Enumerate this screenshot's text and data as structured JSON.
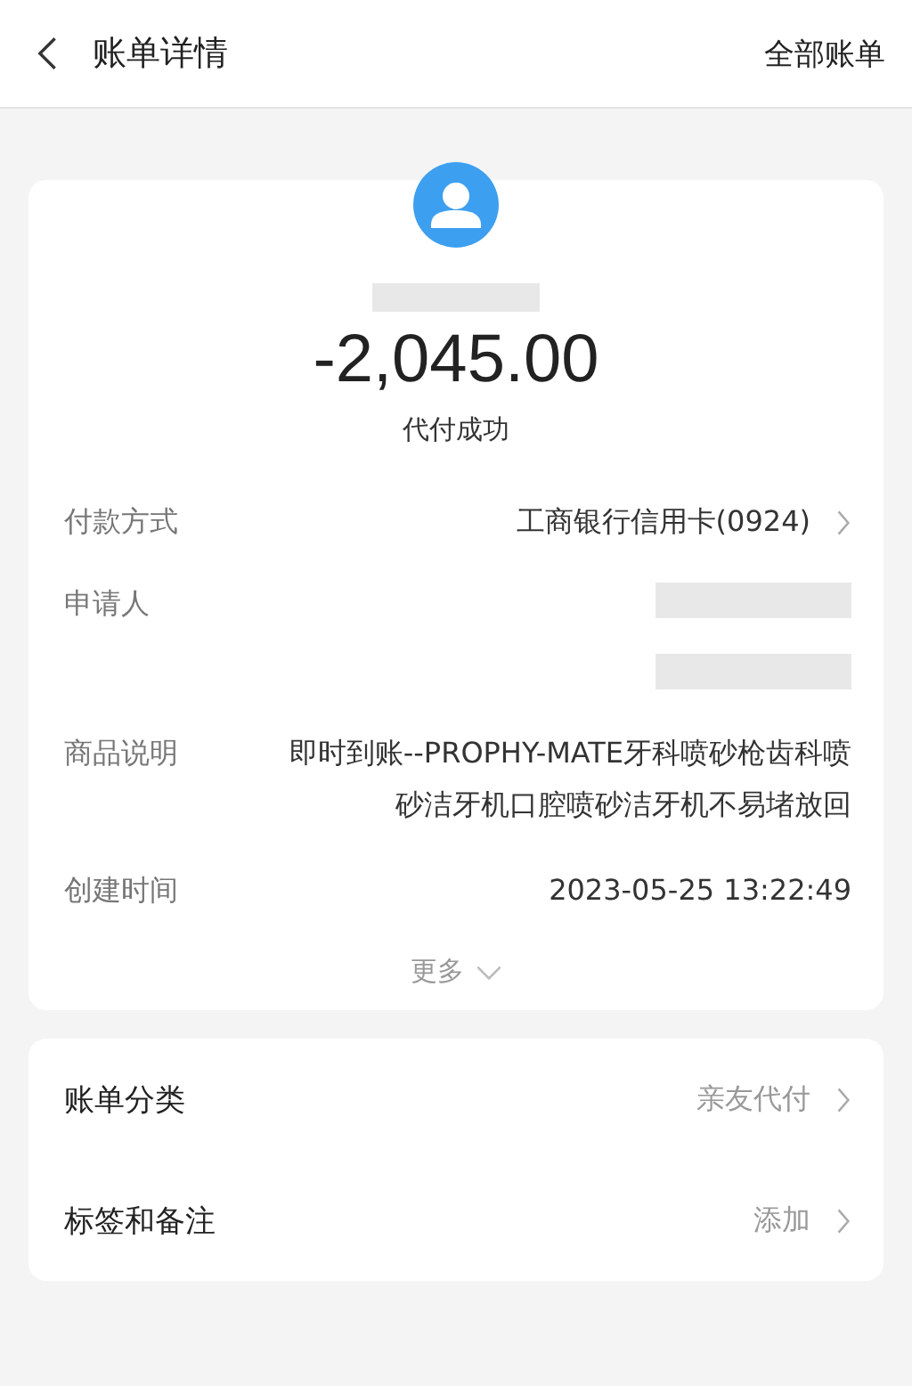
{
  "header": {
    "back_icon": true,
    "title": "账单详情",
    "action": "全部账单"
  },
  "summary": {
    "name_redacted": true,
    "amount": "-2,045.00",
    "status": "代付成功"
  },
  "details": [
    {
      "kind": "link",
      "label": "付款方式",
      "value": "工商银行信用卡(0924)"
    },
    {
      "kind": "redacted",
      "label": "申请人"
    },
    {
      "kind": "redacted"
    },
    {
      "kind": "text",
      "label": "商品说明",
      "value": "即时到账--PROPHY-MATE牙科喷砂枪齿科喷砂洁牙机口腔喷砂洁牙机不易堵放回"
    },
    {
      "kind": "text",
      "label": "创建时间",
      "value": "2023-05-25 13:22:49"
    }
  ],
  "more": {
    "label": "更多",
    "expanded": false
  },
  "options": [
    {
      "label": "账单分类",
      "value": "亲友代付"
    },
    {
      "label": "标签和备注",
      "value": "添加"
    }
  ]
}
